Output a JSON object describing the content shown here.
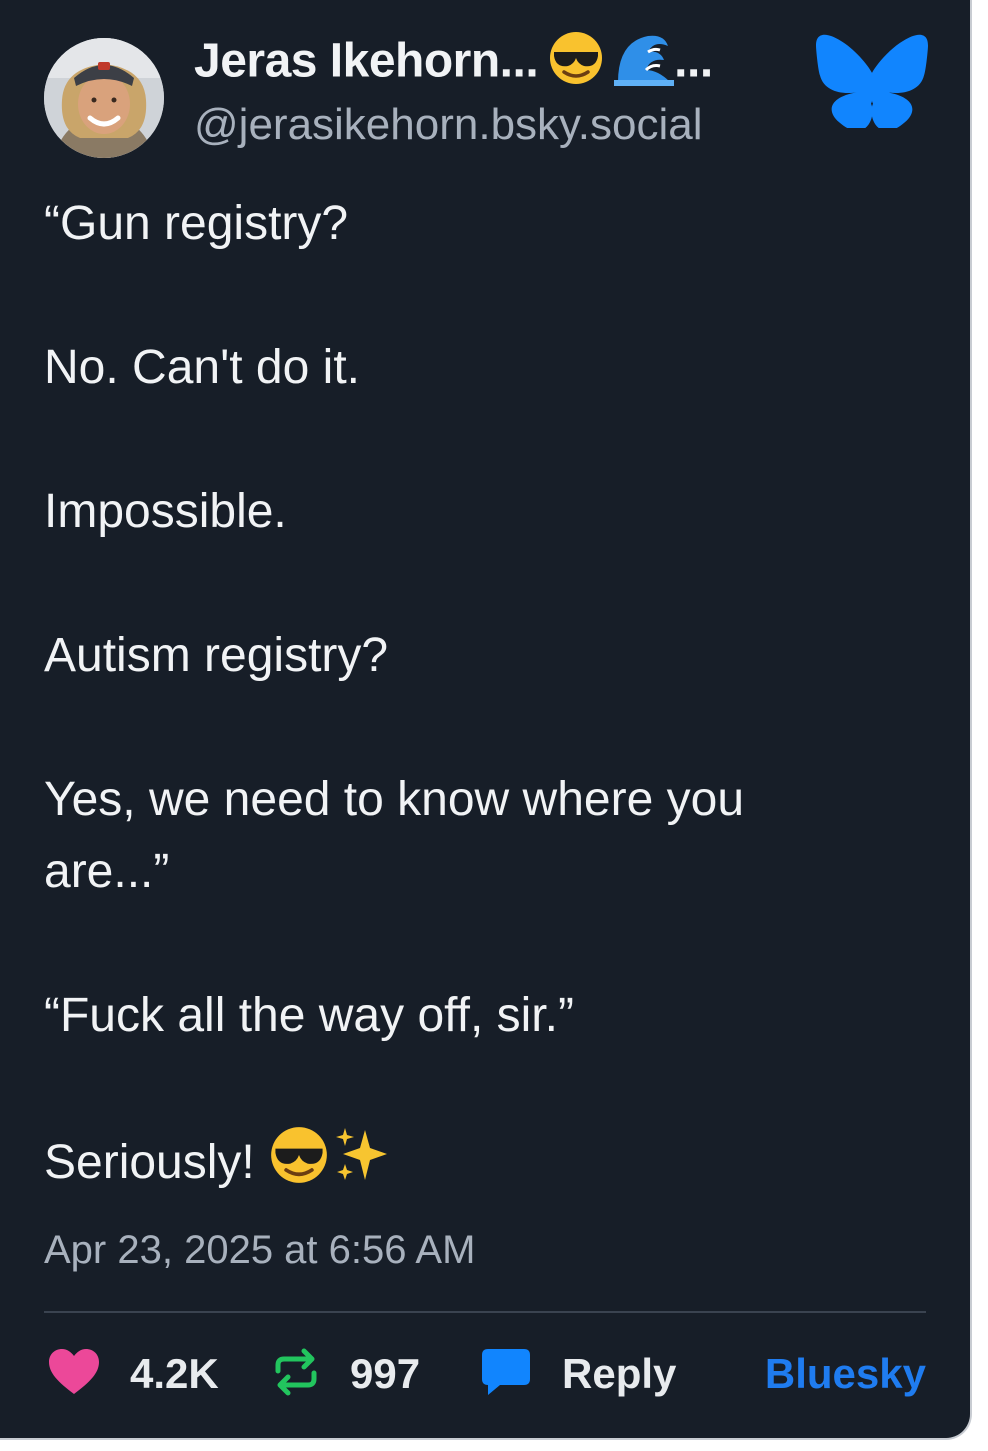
{
  "author": {
    "display_name": "Jeras Ikehorn...",
    "name_emojis": [
      "sunglasses-emoji",
      "wave-emoji"
    ],
    "name_overflow": "...",
    "handle": "@jerasikehorn.bsky.social"
  },
  "platform_icon": "bluesky-butterfly-icon",
  "post": {
    "paragraphs": [
      "“Gun registry?",
      "No. Can't do it.",
      "Impossible.",
      "Autism registry?",
      "Yes, we need to know where you are...”",
      "“Fuck all the way off, sir.”",
      "Seriously!"
    ],
    "trailing_emojis": [
      "sunglasses-emoji",
      "sparkles-emoji"
    ],
    "timestamp": "Apr 23, 2025 at 6:56 AM"
  },
  "actions": {
    "likes": "4.2K",
    "reposts": "997",
    "reply_label": "Reply",
    "open_in_label": "Bluesky"
  },
  "colors": {
    "background": "#171e28",
    "text": "#f1f3f5",
    "secondary_text": "#a8b1bd",
    "brand_blue": "#1f7cf0",
    "like_pink": "#ec4899",
    "repost_green": "#22c55e"
  }
}
